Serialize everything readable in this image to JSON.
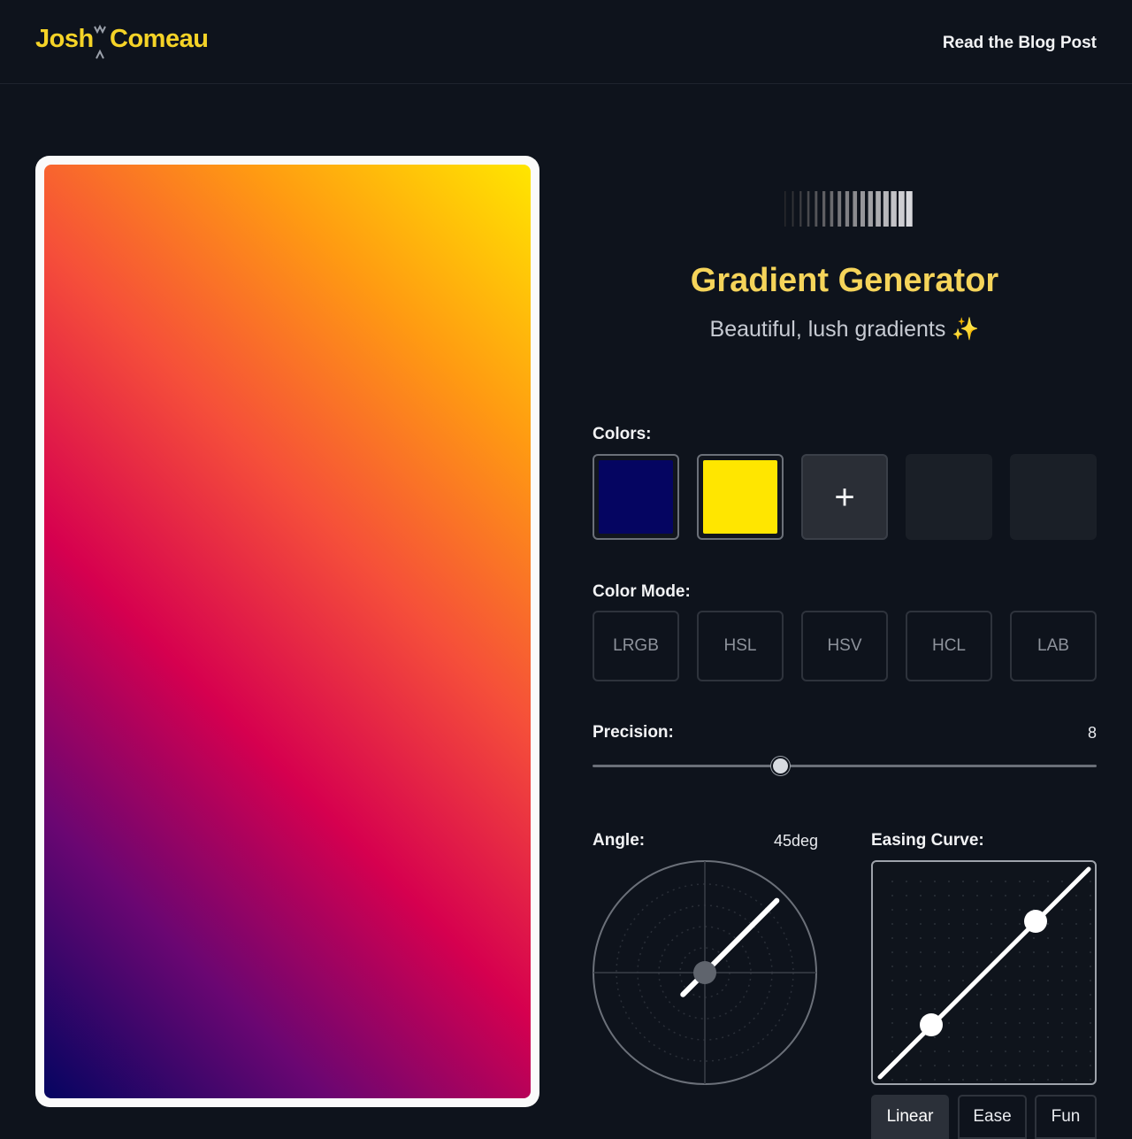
{
  "header": {
    "logo_first": "Josh",
    "logo_last": "Comeau",
    "blog_link": "Read the Blog Post"
  },
  "hero": {
    "title": "Gradient Generator",
    "subtitle": "Beautiful, lush gradients",
    "sparkle_icon": "sparkles-icon"
  },
  "colors": {
    "label": "Colors:",
    "swatches": [
      "#050561",
      "#ffe600"
    ],
    "add_label": "+",
    "empty_slots": 2
  },
  "color_mode": {
    "label": "Color Mode:",
    "options": [
      "LRGB",
      "HSL",
      "HSV",
      "HCL",
      "LAB"
    ],
    "selected": "HCL"
  },
  "precision": {
    "label": "Precision:",
    "value": "8",
    "fraction": 0.374
  },
  "angle": {
    "label": "Angle:",
    "value": "45deg",
    "degrees": 45
  },
  "easing": {
    "label": "Easing Curve:",
    "options": [
      "Linear",
      "Ease",
      "Fun"
    ],
    "selected": "Linear"
  },
  "gradient": {
    "stops": [
      "#050561",
      "#6a0672",
      "#d6004f",
      "#f54e3a",
      "#ff9a12",
      "#ffe600"
    ],
    "angle_deg": 45
  }
}
